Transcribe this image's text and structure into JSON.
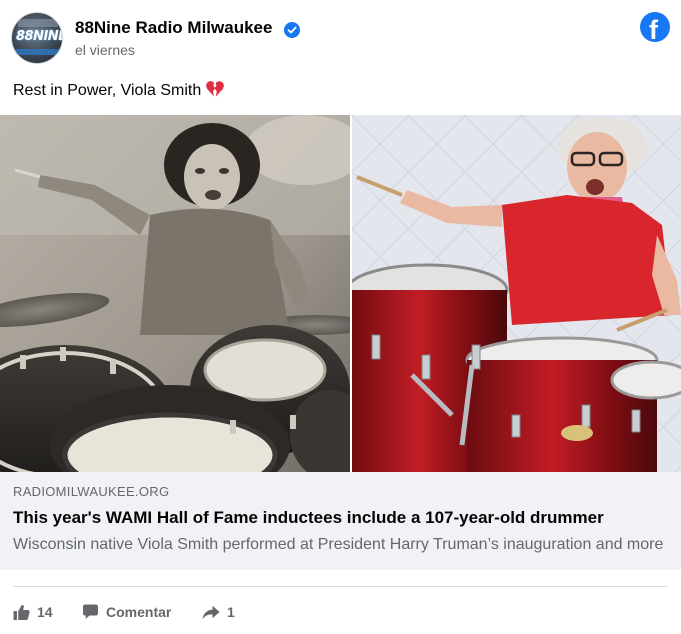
{
  "post": {
    "page_name": "88Nine Radio Milwaukee",
    "avatar_text": "88NINE",
    "timestamp": "el viernes",
    "text": "Rest in Power, Viola Smith",
    "emoji": "broken-heart"
  },
  "link": {
    "domain": "RADIOMILWAUKEE.ORG",
    "title": "This year's WAMI Hall of Fame inductees include a 107-year-old drummer",
    "description": "Wisconsin native Viola Smith performed at President Harry Truman’s inauguration and more"
  },
  "actions": {
    "like_count": "14",
    "comment_label": "Comentar",
    "share_count": "1"
  },
  "colors": {
    "brand_blue": "#1877f2",
    "secondary_text": "#65676b",
    "link_box_bg": "#f0f2f5"
  },
  "icons": [
    "verified-badge-icon",
    "facebook-logo-icon",
    "broken-heart-icon",
    "thumbs-up-icon",
    "comment-icon",
    "share-arrow-icon"
  ]
}
